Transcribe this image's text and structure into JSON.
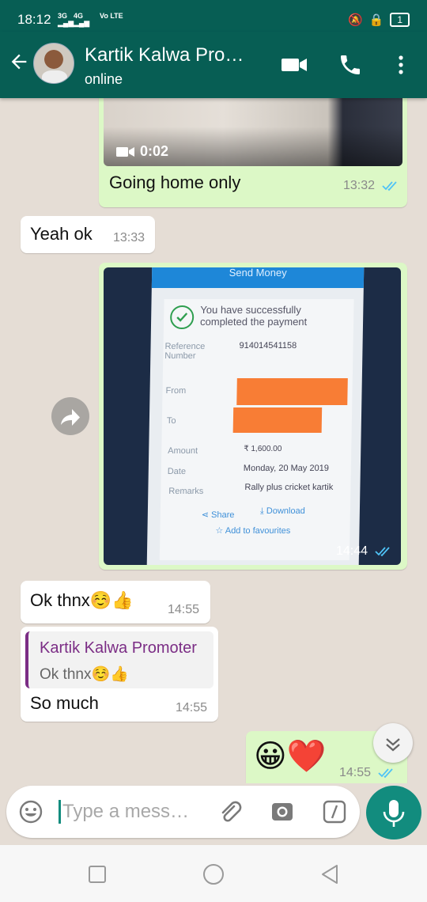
{
  "status_bar": {
    "time": "18:12",
    "network_1": "3G",
    "network_2": "4G",
    "carrier_badge": "Vo LTE",
    "battery": "1"
  },
  "header": {
    "contact_name": "Kartik Kalwa Pro…",
    "status": "online"
  },
  "messages": [
    {
      "direction": "out",
      "type": "video",
      "duration": "0:02",
      "text": "Going home only",
      "time": "13:32",
      "read": true
    },
    {
      "direction": "in",
      "type": "text",
      "text": "Yeah ok",
      "time": "13:33"
    },
    {
      "direction": "out",
      "type": "image",
      "time": "14:44",
      "read": true,
      "image_text": {
        "screen_title": "Send Money",
        "success_line_1": "You have successfully",
        "success_line_2": "completed the payment",
        "reference_label": "Reference Number",
        "reference_value": "914014541158",
        "from_label": "From",
        "to_label": "To",
        "amount_label": "Amount",
        "amount_value": "₹ 1,600.00",
        "date_label": "Date",
        "date_value": "Monday, 20 May 2019",
        "remarks_label": "Remarks",
        "remarks_value": "Rally plus cricket kartik",
        "share_label": "Share",
        "download_label": "Download",
        "favourites_label": "Add to favourites"
      }
    },
    {
      "direction": "in",
      "type": "text",
      "text": "Ok thnx☺️👍",
      "time": "14:55"
    },
    {
      "direction": "in",
      "type": "reply",
      "quoted_name": "Kartik Kalwa Promoter",
      "quoted_text": "Ok thnx☺️👍",
      "text": "So much",
      "time": "14:55"
    },
    {
      "direction": "out",
      "type": "emoji",
      "text": "😀❤️",
      "time": "14:55",
      "read": true
    }
  ],
  "composer": {
    "placeholder": "Type a mess…",
    "icons": [
      "emoji-icon",
      "attach-icon",
      "camera-icon",
      "gif-icon",
      "mic-icon"
    ]
  },
  "colors": {
    "header": "#075e54",
    "outgoing_bubble": "#dcf8c6",
    "incoming_bubble": "#ffffff",
    "chat_background": "#e5ddd5",
    "read_ticks": "#4fc3f7",
    "accent": "#128c7e",
    "quote_author": "#7b2d85"
  }
}
